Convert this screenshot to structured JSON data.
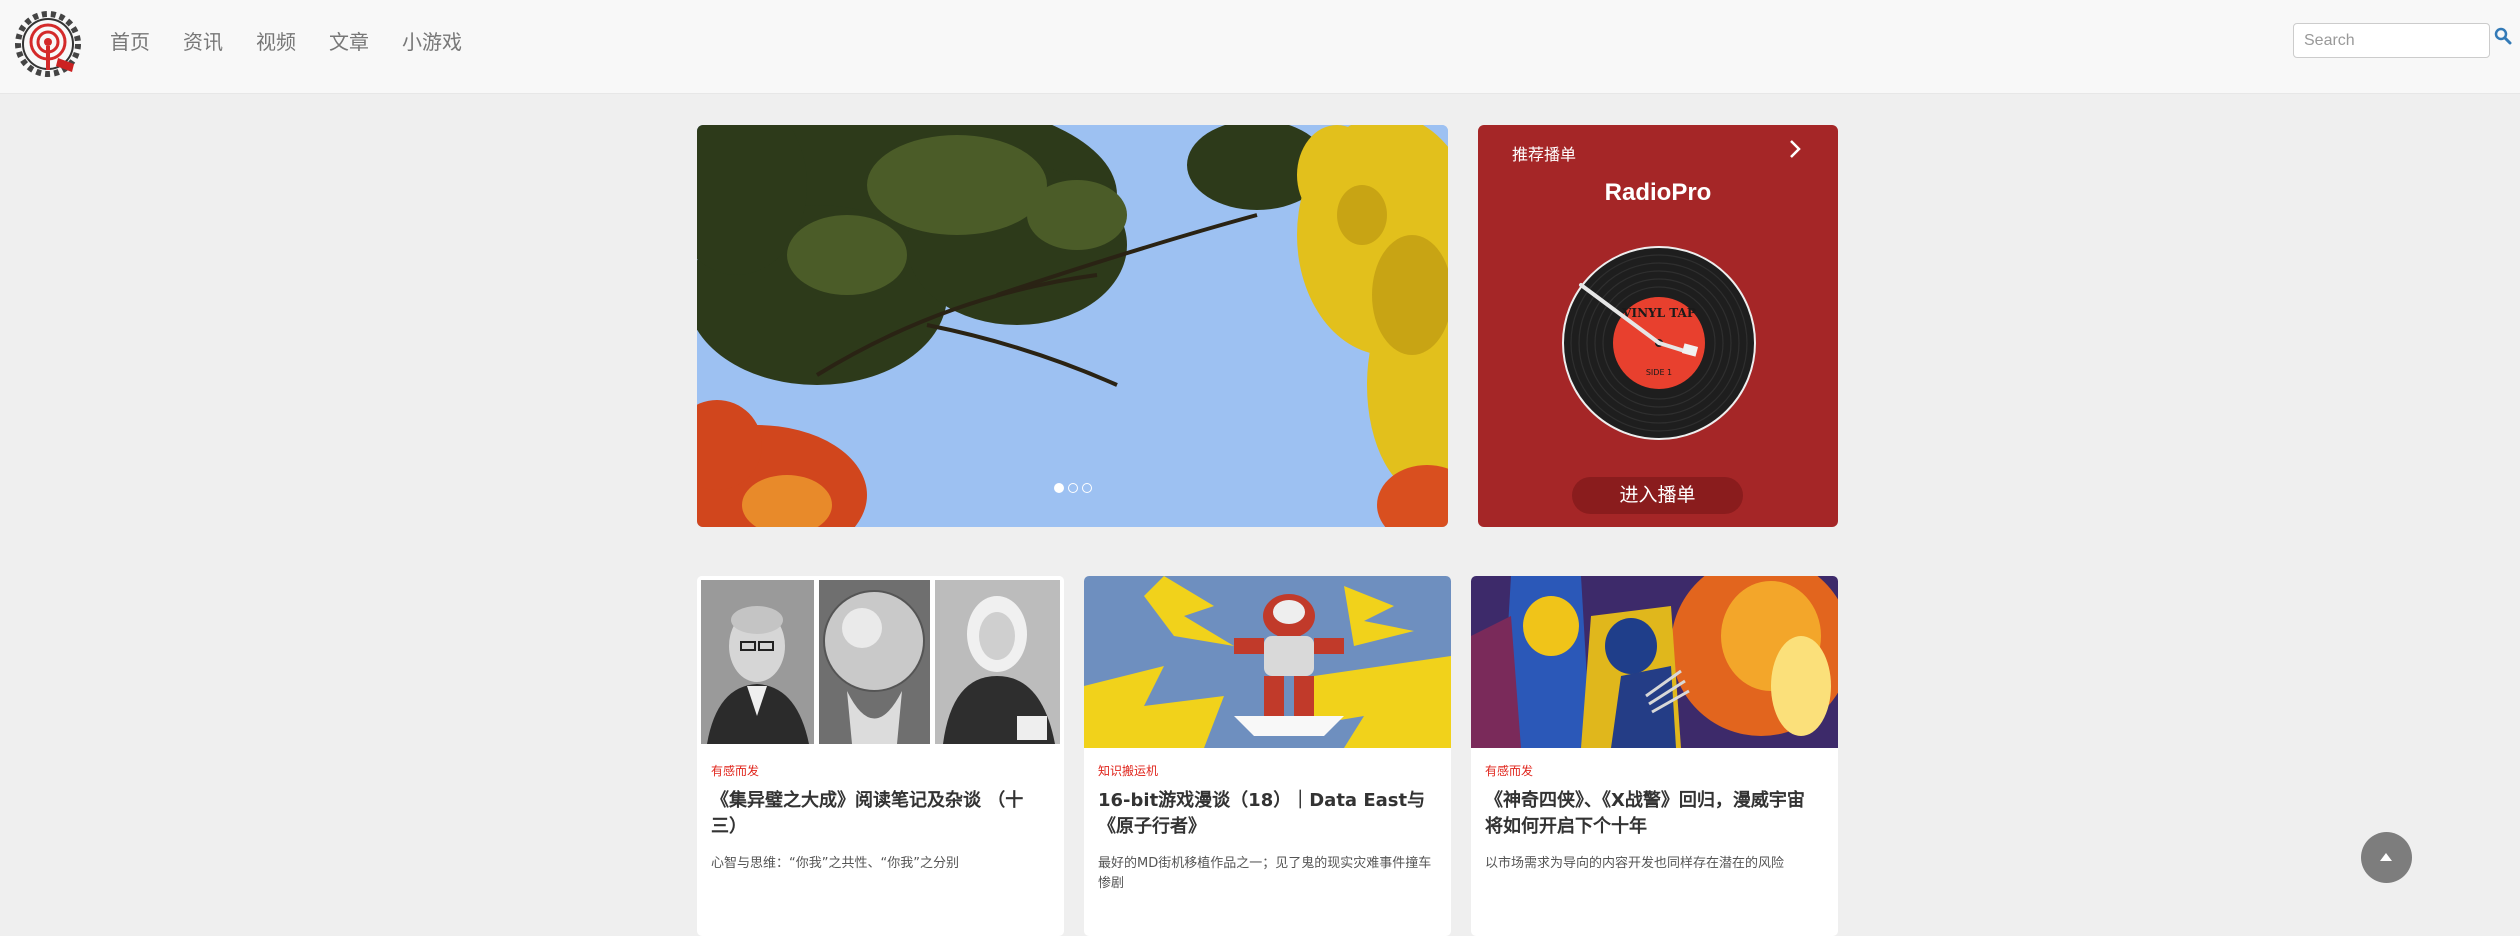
{
  "nav": {
    "logo_alt": "site logo",
    "links": [
      "首页",
      "资讯",
      "视频",
      "文章",
      "小游戏"
    ],
    "search_placeholder": "Search"
  },
  "hero": {
    "slide_count": 3,
    "active_slide": 1
  },
  "playlist": {
    "header": "推荐播单",
    "title": "RadioPro",
    "button_label": "进入播单",
    "record_label": "VINYL TAP",
    "record_side": "SIDE 1"
  },
  "cards": [
    {
      "tag": "有感而发",
      "title": "《集异璧之大成》阅读笔记及杂谈 （十三）",
      "desc": "心智与思维：“你我”之共性、“你我”之分别"
    },
    {
      "tag": "知识搬运机",
      "title": "16-bit游戏漫谈（18）｜Data East与《原子行者》",
      "desc": "最好的MD街机移植作品之一；见了鬼的现实灾难事件撞车惨剧"
    },
    {
      "tag": "有感而发",
      "title": "《神奇四侠》、《X战警》回归，漫威宇宙将如何开启下个十年",
      "desc": "以市场需求为导向的内容开发也同样存在潜在的风险"
    }
  ],
  "colors": {
    "playlist_bg": "#a52627",
    "tag_red": "#e0251c",
    "nav_bg": "#f8f8f8",
    "page_bg": "#efefef"
  }
}
